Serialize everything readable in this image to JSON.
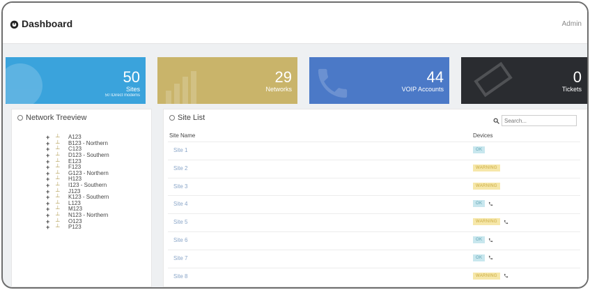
{
  "header": {
    "title": "Dashboard",
    "user": "Admin"
  },
  "tiles": [
    {
      "value": "50",
      "label": "Sites",
      "sub": "50 IDirect modems",
      "color": "#3aa3dc",
      "icon": "globe-icon"
    },
    {
      "value": "29",
      "label": "Networks",
      "sub": "",
      "color": "#c9b46a",
      "icon": "bar-chart-icon"
    },
    {
      "value": "44",
      "label": "VOIP Accounts",
      "sub": "",
      "color": "#4b79c7",
      "icon": "phone-icon"
    },
    {
      "value": "0",
      "label": "Tickets",
      "sub": "",
      "color": "#2a2c30",
      "icon": "ticket-icon"
    }
  ],
  "tree": {
    "title": "Network Treeview",
    "items": [
      "A123",
      "B123 - Northern",
      "C123",
      "D123 - Southern",
      "E123",
      "F123",
      "G123 - Northern",
      "H123",
      "I123 - Southern",
      "J123",
      "K123 - Southern",
      "L123",
      "M123",
      "N123 - Northern",
      "O123",
      "P123"
    ]
  },
  "sites": {
    "title": "Site List",
    "search_placeholder": "Search...",
    "columns": [
      "Site Name",
      "Devices"
    ],
    "rows": [
      {
        "name": "Site 1",
        "status": "OK",
        "phone": false
      },
      {
        "name": "Site 2",
        "status": "WARNING",
        "phone": false
      },
      {
        "name": "Site 3",
        "status": "WARNING",
        "phone": false
      },
      {
        "name": "Site 4",
        "status": "OK",
        "phone": true
      },
      {
        "name": "Site 5",
        "status": "WARNING",
        "phone": true
      },
      {
        "name": "Site 6",
        "status": "OK",
        "phone": true
      },
      {
        "name": "Site 7",
        "status": "OK",
        "phone": true
      },
      {
        "name": "Site 8",
        "status": "WARNING",
        "phone": true
      }
    ]
  }
}
